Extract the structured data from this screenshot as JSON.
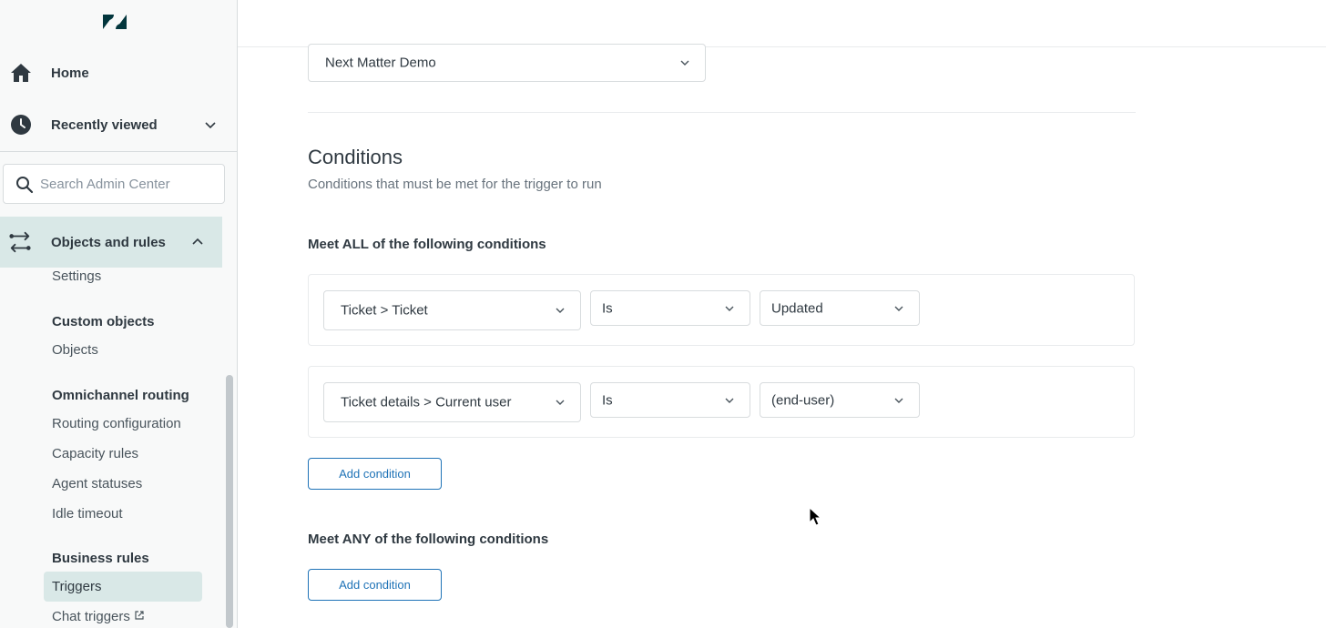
{
  "sidebar": {
    "logo": "zendesk-logo",
    "home_label": "Home",
    "recent_label": "Recently viewed",
    "search_placeholder": "Search Admin Center",
    "objects_label": "Objects and rules",
    "settings": "Settings",
    "custom_objects_heading": "Custom objects",
    "objects_item": "Objects",
    "omnichannel_heading": "Omnichannel routing",
    "routing_configuration": "Routing configuration",
    "capacity_rules": "Capacity rules",
    "agent_statuses": "Agent statuses",
    "idle_timeout": "Idle timeout",
    "business_rules_heading": "Business rules",
    "triggers": "Triggers",
    "chat_triggers": "Chat triggers",
    "active_color": "#d9e8e7"
  },
  "main": {
    "category_select_value": "Next Matter Demo",
    "conditions_title": "Conditions",
    "conditions_desc": "Conditions that must be met for the trigger to run",
    "all_label": "Meet ALL of the following conditions",
    "conditions": [
      {
        "field": "Ticket > Ticket",
        "operator": "Is",
        "value": "Updated"
      },
      {
        "field": "Ticket details > Current user",
        "operator": "Is",
        "value": "(end-user)"
      }
    ],
    "add_condition_label": "Add condition",
    "any_label": "Meet ANY of the following conditions",
    "accent_color": "#1f73b7"
  }
}
